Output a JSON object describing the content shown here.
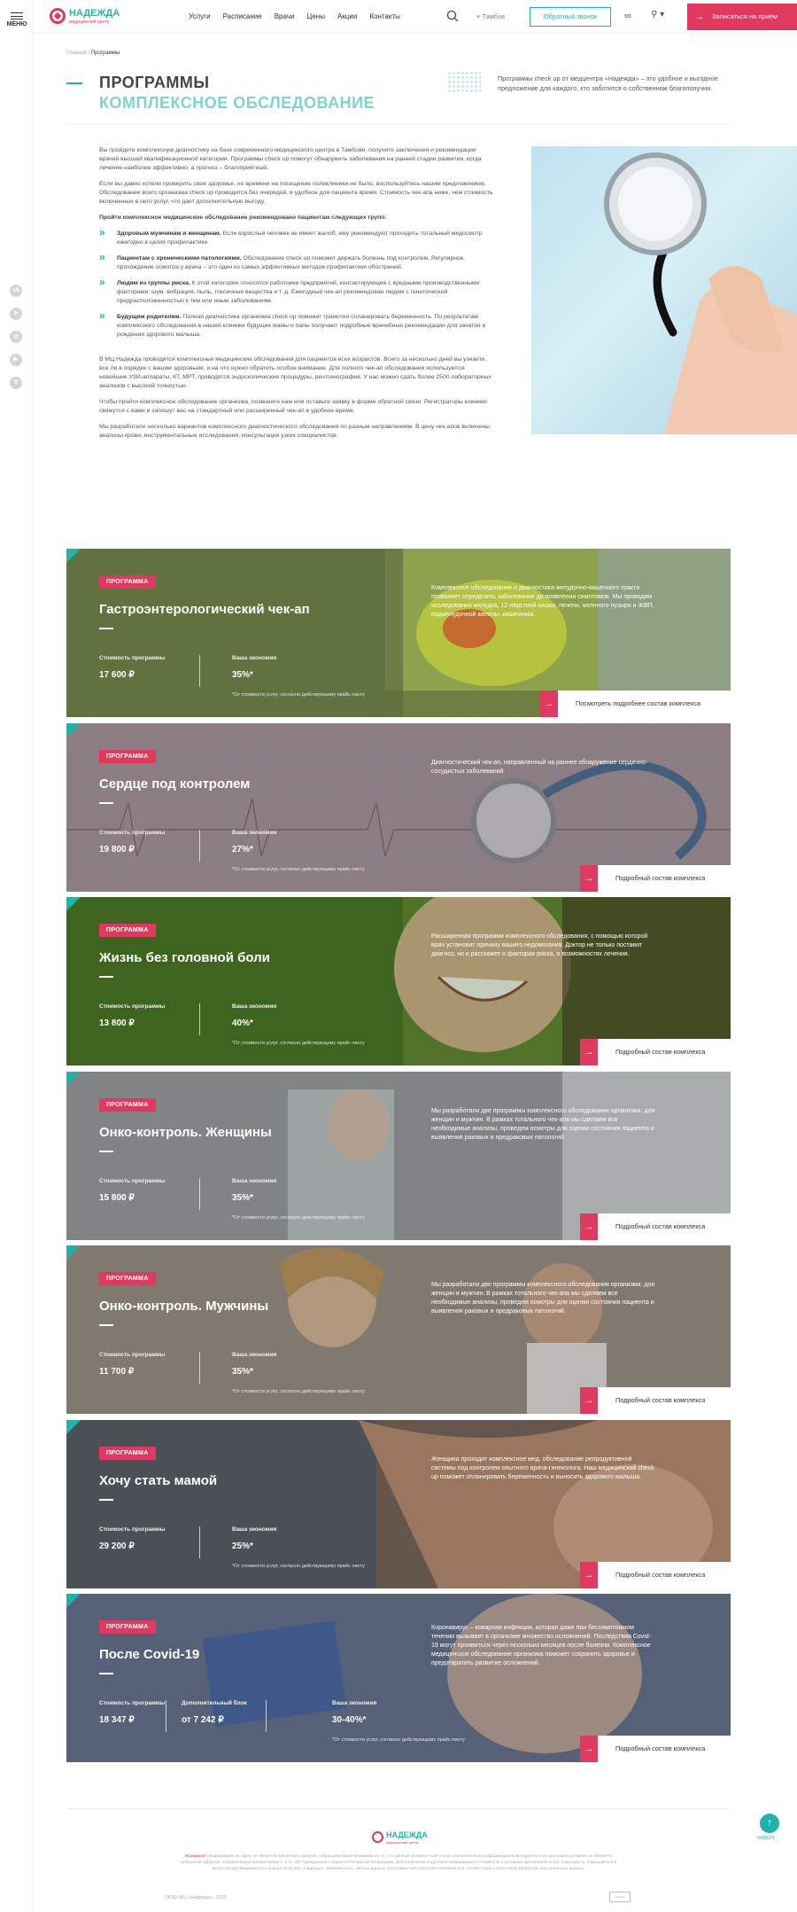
{
  "rail": {
    "menu_label": "МЕНЮ",
    "social": [
      "vk",
      "telegram",
      "ok",
      "youtube",
      "odnoklassniki"
    ]
  },
  "header": {
    "logo_title": "НАДЕЖДА",
    "logo_subtitle": "медицинский центр",
    "nav": [
      "Услуги",
      "Расписание",
      "Врачи",
      "Цены",
      "Акции",
      "Контакты"
    ],
    "city": "Тамбов",
    "callback": "Обратный звонок",
    "cta": "Записаться на приём"
  },
  "breadcrumbs": {
    "home": "Главная",
    "current": "Программы"
  },
  "page": {
    "title1": "ПРОГРАММЫ",
    "title2": "КОМПЛЕКСНОЕ ОБСЛЕДОВАНИЕ",
    "lead": "Программы check up от медцентра «Надежда» – это удобное и выгодное предложение для каждого, кто заботится о собственном благополучии."
  },
  "intro": {
    "p1": "Вы пройдете комплексную диагностику на базе современного медицинского центра в Тамбове, получите заключения и рекомендации врачей высшей квалификационной категории. Программы check up помогут обнаружить заболевания на ранней стадии развития, когда лечение наиболее эффективно, а прогноз – благоприятный.",
    "p2": "Если вы давно хотели проверить свое здоровье, но времени на посещение поликлиники не было, воспользуйтесь нашим предложением. Обследование всего организма check up проводится без очередей, в удобное для пациента время. Стоимость чек-апа ниже, чем стоимость включенных в него услуг, что дает дополнительную выгоду.",
    "list_title": "Пройти комплексное медицинское обследование рекомендовано пациентам следующих групп:",
    "items": [
      {
        "b": "Здоровым мужчинам и женщинам.",
        "t": " Если взрослый человек не имеет жалоб, ему рекомендуют проходить тотальный медосмотр ежегодно в целях профилактики."
      },
      {
        "b": "Пациентам с хроническими патологиями.",
        "t": " Обследование check up поможет держать болезнь под контролем. Регулярное прохождение осмотра у врача – это один из самых эффективных методов профилактики обострений."
      },
      {
        "b": "Людям из группы риска.",
        "t": " К этой категории относятся работники предприятий, контактирующие с вредными производственными факторами: шум, вибрация, пыль, токсичные вещества и т. д. Ежегодный чек-ап рекомендован людям с генетической предрасположенностью к тем или иным заболеваниям."
      },
      {
        "b": "Будущим родителям.",
        "t": " Полная диагностика организма check up поможет грамотно спланировать беременность. По результатам комплексного обследования в нашей клинике будущие мамы и папы получают подробные врачебные рекомендации для зачатия и рождения здорового малыша."
      }
    ],
    "p3": "В МЦ Надежда проводятся комплексные медицинские обследования для пациентов всех возрастов. Всего за несколько дней вы узнаете, все ли в порядке с вашим здоровьем, и на что нужно обратить особое внимание. Для полного чек-ап обследования используются новейшие УЗИ-аппараты, КТ, МРТ, проводятся эндоскопические процедуры, рентгенография. У нас можно сдать более 2500 лабораторных анализов с высокой точностью.",
    "p4": "Чтобы пройти комплексное обследование организма, позвоните нам или оставьте заявку в форме обратной связи. Регистраторы клиники свяжутся с вами и запишут вас на стандартный или расширенный чек-ап в удобное время.",
    "p5": "Мы разработали несколько вариантов комплексного диагностического обследования по разным направлениям. В цену чек-апов включены анализы крови, инструментальные исследования, консультации узких специалистов."
  },
  "labels": {
    "tag": "ПРОГРАММА",
    "price": "Стоимость программы",
    "saving": "Ваша экономия",
    "extra": "Дополнительный блок",
    "note": "*От стоимости услуг, согласно действующему прайс-листу"
  },
  "programs": [
    {
      "name": "Гастроэнтерологический чек-ап",
      "desc": "Комплексное обследование и диагностика желудочно-кишечного тракта позволяет определить заболевание до появления симптомов. Мы проводим исследования желудка, 12-перстной кишки, печени, желчного пузыря и ЖВП, поджелудочной железы, кишечника.",
      "price": "17 600 ₽",
      "saving": "35%*",
      "more": "Посмотреть подробнее состав комплекса",
      "color": "#7d8a45"
    },
    {
      "name": "Сердце под контролем",
      "desc": "Диагностический чек-ап, направленный на раннее обнаружение сердечно-сосудистых заболеваний.",
      "price": "19 800 ₽",
      "saving": "27%*",
      "more": "Подробный состав комплекса",
      "color": "#8a7b80"
    },
    {
      "name": "Жизнь без головной боли",
      "desc": "Расширенная программа комплексного обследования, с помощью которой врач установит причину вашего недомогания. Доктор не только поставит диагноз, но и расскажет о факторах риска, о возможностях лечения.",
      "price": "13 800 ₽",
      "saving": "40%*",
      "more": "Подробный состав комплекса",
      "color": "#5e7a2a"
    },
    {
      "name": "Онко-контроль. Женщины",
      "desc": "Мы разработали две программы комплексного обследования организма: для женщин и мужчин. В рамках тотального чек-апа мы сделаем все необходимые анализы, проведем осмотры для оценки состояния пациента и выявления раковых и предраковых патологий.",
      "price": "15 800 ₽",
      "saving": "35%*",
      "more": "Подробный состав комплекса",
      "color": "#7e8282"
    },
    {
      "name": "Онко-контроль. Мужчины",
      "desc": "Мы разработали две программы комплексного обследования организма: для женщин и мужчин. В рамках тотального чек-апа мы сделаем все необходимые анализы, проведем осмотры для оценки состояния пациента и выявления раковых и предраковых патологий.",
      "price": "11 700 ₽",
      "saving": "35%*",
      "more": "Подробный состав комплекса",
      "color": "#8b8277"
    },
    {
      "name": "Хочу стать мамой",
      "desc": "Женщина проходит комплексное мед. обследование репродуктивной системы под контролем опытного врача-гинеколога. Наш медицинский check up поможет спланировать беременность и выносить здорового малыша.",
      "price": "29 200 ₽",
      "saving": "25%*",
      "more": "Подробный состав комплекса",
      "color": "#6f6258"
    },
    {
      "name": "После Covid-19",
      "desc": "Коронавирус – коварная инфекция, которая даже при бессимптомном течении вызывает в организме множество осложнений. Последствия Covid-19 могут проявиться через несколько месяцев после болезни. Комплексное медицинское обследование организма поможет сохранить здоровье и предотвратить развитие осложнений.",
      "price": "18 347 ₽",
      "extra": "от 7 242 ₽",
      "saving": "30-40%*",
      "more": "Подробный состав комплекса",
      "color": "#5d6a80"
    }
  ],
  "footer": {
    "up": "НАВЕРХ",
    "logo_title": "НАДЕЖДА",
    "logo_subtitle": "медицинский центр",
    "note_label": "Внимание!",
    "note": " Информация на сайте не является публичной офертой. Обращаем Ваше внимание на то, что данный интернет-сайт носит исключительно информационный характер и ни при каких условиях не является публичной офертой, определяемой положениями ч. 2 ст. 437 Гражданского кодекса Российской Федерации. Для получения подробной информации о стоимости и условиях выполнения услуг, пожалуйста, обращайтесь в регистратуру медицинского центра ООО МЦ «Надежда». Безопасность личных данных пользователей сайта обеспечивается в соответствии с политикой обработки персональных данных.",
    "copy": "ООО МЦ «Надежда», 2021"
  }
}
